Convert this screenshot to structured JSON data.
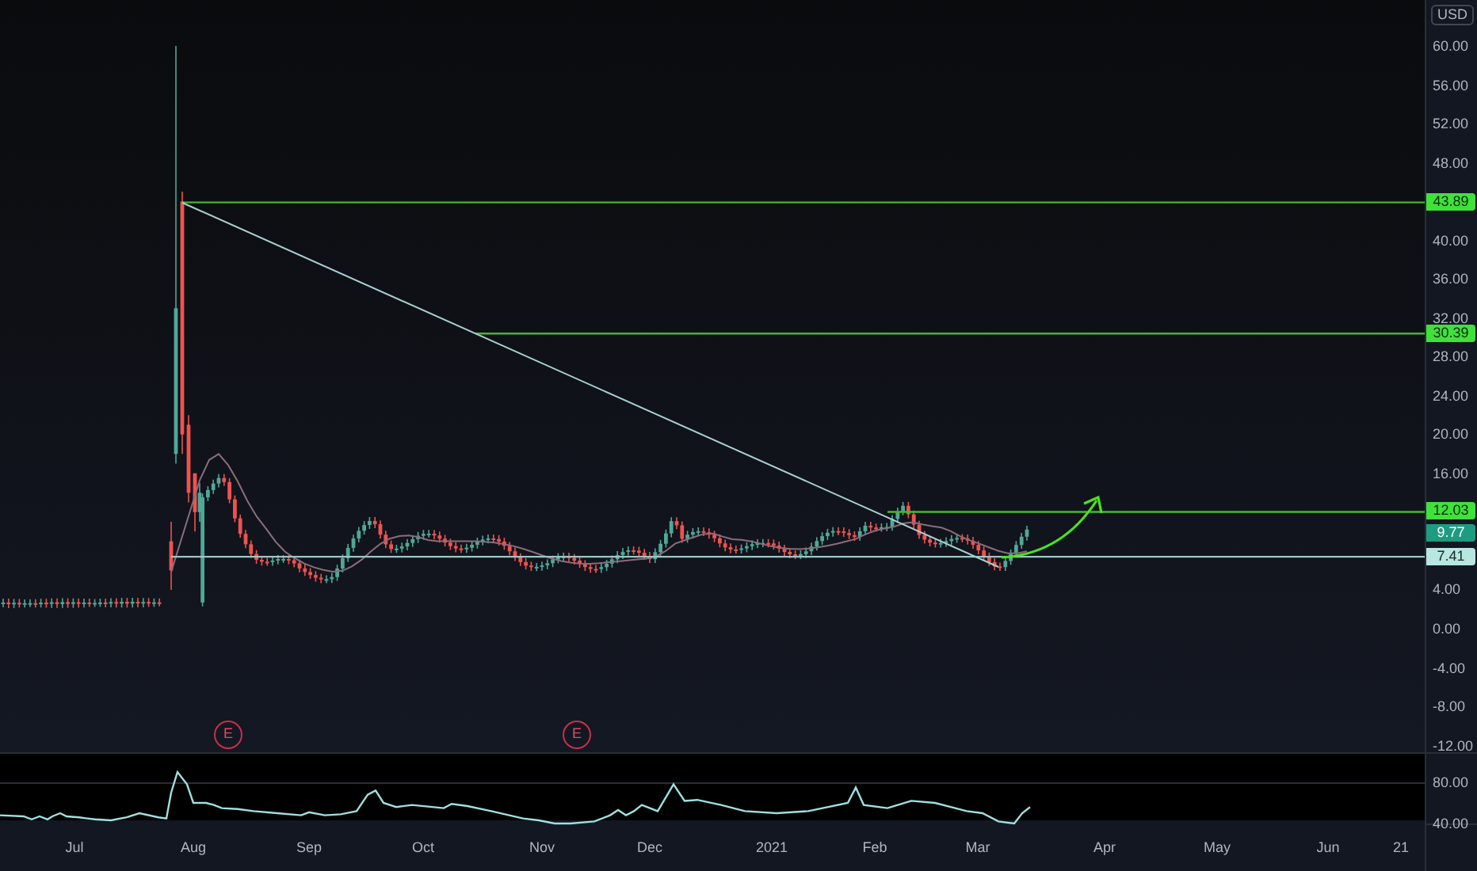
{
  "price_axis": {
    "currency": "USD",
    "ticks": [
      "60.00",
      "56.00",
      "52.00",
      "48.00",
      "40.00",
      "36.00",
      "32.00",
      "28.00",
      "24.00",
      "20.00",
      "16.00",
      "4.00",
      "0.00",
      "-4.00",
      "-8.00",
      "-12.00"
    ]
  },
  "price_labels": [
    {
      "text": "43.89",
      "kind": "level"
    },
    {
      "text": "30.39",
      "kind": "level"
    },
    {
      "text": "12.03",
      "kind": "level"
    },
    {
      "text": "9.77",
      "kind": "last"
    },
    {
      "text": "7.41",
      "kind": "support"
    }
  ],
  "earnings_markers": [
    {
      "label": "E"
    },
    {
      "label": "E"
    }
  ],
  "oscillator_axis": {
    "ticks": [
      "80.00",
      "40.00"
    ]
  },
  "time_axis": {
    "labels": [
      "Jul",
      "Aug",
      "Sep",
      "Oct",
      "Nov",
      "Dec",
      "2021",
      "Feb",
      "Mar",
      "Apr",
      "May",
      "Jun",
      "21"
    ]
  }
}
